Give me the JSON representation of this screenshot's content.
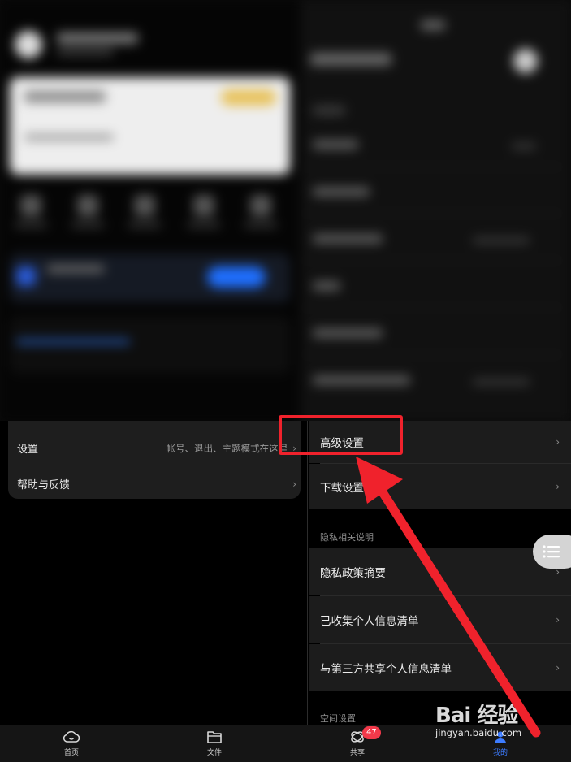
{
  "left_panel": {
    "items": [
      {
        "label": "设置",
        "desc": "帐号、退出、主题模式在这里"
      },
      {
        "label": "帮助与反馈",
        "desc": ""
      }
    ]
  },
  "right_panel": {
    "items": [
      {
        "label": "高级设置"
      },
      {
        "label": "下载设置"
      }
    ],
    "privacy_header": "隐私相关说明",
    "privacy_items": [
      {
        "label": "隐私政策摘要"
      },
      {
        "label": "已收集个人信息清单"
      },
      {
        "label": "与第三方共享个人信息清单"
      }
    ],
    "space_header": "空间设置"
  },
  "bottom_nav": {
    "items": [
      {
        "label": "首页",
        "icon": "cloud-home-icon"
      },
      {
        "label": "文件",
        "icon": "folder-icon"
      },
      {
        "label": "共享",
        "icon": "share-icon",
        "badge": "47"
      },
      {
        "label": "我的",
        "icon": "user-icon",
        "active": true
      }
    ]
  },
  "watermark": {
    "logo": "Bai 经验",
    "url": "jingyan.baidu.com"
  },
  "colors": {
    "accent": "#3d7cff",
    "annotation": "#f0222c",
    "badge": "#f2394a"
  }
}
